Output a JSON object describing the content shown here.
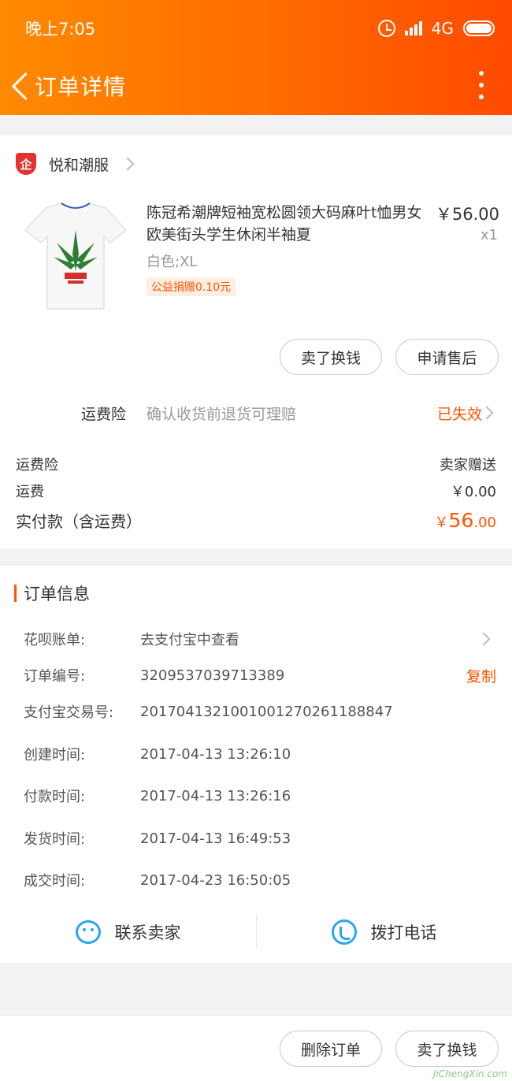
{
  "status_bar": {
    "time": "晚上7:05",
    "network": "4G"
  },
  "nav": {
    "title": "订单详情"
  },
  "shop": {
    "icon_text": "企",
    "name": "悦和潮服"
  },
  "product": {
    "title": "陈冠希潮牌短袖宽松圆领大码麻叶t恤男女 欧美街头学生休闲半袖夏",
    "spec": "白色;XL",
    "charity": "公益捐赠0.10元",
    "price": "￥56.00",
    "qty": "x1"
  },
  "actions": {
    "sell": "卖了换钱",
    "aftersale": "申请售后"
  },
  "insurance": {
    "label": "运费险",
    "desc": "确认收货前退货可理赔",
    "status": "已失效"
  },
  "fees": [
    {
      "label": "运费险",
      "value": "卖家赠送"
    },
    {
      "label": "运费",
      "value": "￥0.00"
    }
  ],
  "total": {
    "label": "实付款（含运费）",
    "symbol": "￥",
    "int": "56",
    "dec": ".00"
  },
  "order_info": {
    "title": "订单信息",
    "rows": [
      {
        "label": "花呗账单:",
        "value": "去支付宝中查看"
      },
      {
        "label": "订单编号:",
        "value": "3209537039713389",
        "action": "复制"
      },
      {
        "label": "支付宝交易号:",
        "value": "2017041321001001270261188847"
      },
      {
        "label": "创建时间:",
        "value": "2017-04-13 13:26:10"
      },
      {
        "label": "付款时间:",
        "value": "2017-04-13 13:26:16"
      },
      {
        "label": "发货时间:",
        "value": "2017-04-13 16:49:53"
      },
      {
        "label": "成交时间:",
        "value": "2017-04-23 16:50:05"
      }
    ]
  },
  "contact": {
    "seller": "联系卖家",
    "phone": "拨打电话"
  },
  "bottom": {
    "delete": "删除订单",
    "sell": "卖了换钱"
  },
  "watermark": "JiChengXin.com",
  "colors": {
    "accent": "#ff5500",
    "header_start": "#ff8a00",
    "header_end": "#ff4a00",
    "icon_blue": "#2aa5f5"
  }
}
